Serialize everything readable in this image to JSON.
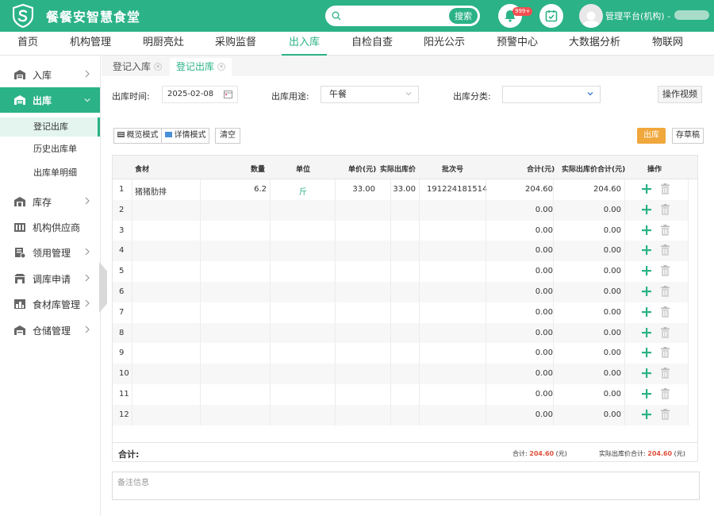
{
  "app": {
    "title": "餐餐安智慧食堂",
    "search_placeholder": "",
    "search_button": "搜索",
    "notification_badge": "999+",
    "user_label": "管理平台(机构) -"
  },
  "colors": {
    "brand": "#2bb287",
    "accent_orange": "#f0a73c",
    "total_red": "#e0523c"
  },
  "nav": [
    "首页",
    "机构管理",
    "明厨亮灶",
    "采购监督",
    "出入库",
    "自检自查",
    "阳光公示",
    "预警中心",
    "大数据分析",
    "物联网"
  ],
  "nav_active": "出入库",
  "sidebar": {
    "groups": [
      {
        "label": "入库",
        "icon": "warehouse-icon"
      },
      {
        "label": "出库",
        "icon": "warehouse-out-icon",
        "active": true
      },
      {
        "label": "库存",
        "icon": "inventory-icon"
      },
      {
        "label": "机构供应商",
        "icon": "supplier-icon"
      },
      {
        "label": "领用管理",
        "icon": "requisition-icon"
      },
      {
        "label": "调库申请",
        "icon": "transfer-icon"
      },
      {
        "label": "食材库管理",
        "icon": "ingredient-store-icon"
      },
      {
        "label": "仓储管理",
        "icon": "storage-icon"
      }
    ],
    "sub_items": [
      "登记出库",
      "历史出库单",
      "出库单明细"
    ]
  },
  "tabs": [
    "登记入库",
    "登记出库"
  ],
  "form": {
    "time_label": "出库时间:",
    "time_value": "2025-02-08",
    "use_label": "出库用途:",
    "use_value": "午餐",
    "category_label": "出库分类:",
    "category_value": "",
    "video_button": "操作视频"
  },
  "toolbar": {
    "overview_mode": "概览模式",
    "detail_mode": "详情模式",
    "clear": "清空",
    "out": "出库",
    "save_draft": "存草稿"
  },
  "table": {
    "headers": [
      "食材",
      "数量",
      "单位",
      "单价(元)",
      "实际出库价",
      "批次号",
      "合计(元)",
      "实际出库价合计(元)",
      "操作"
    ],
    "rows": [
      {
        "no": "1",
        "name": "猪猪肋排",
        "qty": "6.2",
        "unit": "斤",
        "price": "33.00",
        "actual_price": "33.00",
        "batch": "191224181514",
        "total": "204.60",
        "actual_total": "204.60"
      },
      {
        "no": "2",
        "name": "",
        "qty": "",
        "unit": "",
        "price": "",
        "actual_price": "",
        "batch": "",
        "total": "0.00",
        "actual_total": "0.00"
      },
      {
        "no": "3",
        "name": "",
        "qty": "",
        "unit": "",
        "price": "",
        "actual_price": "",
        "batch": "",
        "total": "0.00",
        "actual_total": "0.00"
      },
      {
        "no": "4",
        "name": "",
        "qty": "",
        "unit": "",
        "price": "",
        "actual_price": "",
        "batch": "",
        "total": "0.00",
        "actual_total": "0.00"
      },
      {
        "no": "5",
        "name": "",
        "qty": "",
        "unit": "",
        "price": "",
        "actual_price": "",
        "batch": "",
        "total": "0.00",
        "actual_total": "0.00"
      },
      {
        "no": "6",
        "name": "",
        "qty": "",
        "unit": "",
        "price": "",
        "actual_price": "",
        "batch": "",
        "total": "0.00",
        "actual_total": "0.00"
      },
      {
        "no": "7",
        "name": "",
        "qty": "",
        "unit": "",
        "price": "",
        "actual_price": "",
        "batch": "",
        "total": "0.00",
        "actual_total": "0.00"
      },
      {
        "no": "8",
        "name": "",
        "qty": "",
        "unit": "",
        "price": "",
        "actual_price": "",
        "batch": "",
        "total": "0.00",
        "actual_total": "0.00"
      },
      {
        "no": "9",
        "name": "",
        "qty": "",
        "unit": "",
        "price": "",
        "actual_price": "",
        "batch": "",
        "total": "0.00",
        "actual_total": "0.00"
      },
      {
        "no": "10",
        "name": "",
        "qty": "",
        "unit": "",
        "price": "",
        "actual_price": "",
        "batch": "",
        "total": "0.00",
        "actual_total": "0.00"
      },
      {
        "no": "11",
        "name": "",
        "qty": "",
        "unit": "",
        "price": "",
        "actual_price": "",
        "batch": "",
        "total": "0.00",
        "actual_total": "0.00"
      },
      {
        "no": "12",
        "name": "",
        "qty": "",
        "unit": "",
        "price": "",
        "actual_price": "",
        "batch": "",
        "total": "0.00",
        "actual_total": "0.00"
      }
    ],
    "footer": {
      "total_label": "合计:",
      "sum_label": "合计:",
      "sum_value": "204.60",
      "sum_unit": "(元)",
      "actual_sum_label": "实际出库价合计:",
      "actual_sum_value": "204.60",
      "actual_sum_unit": "(元)"
    }
  },
  "remark_placeholder": "备注信息"
}
